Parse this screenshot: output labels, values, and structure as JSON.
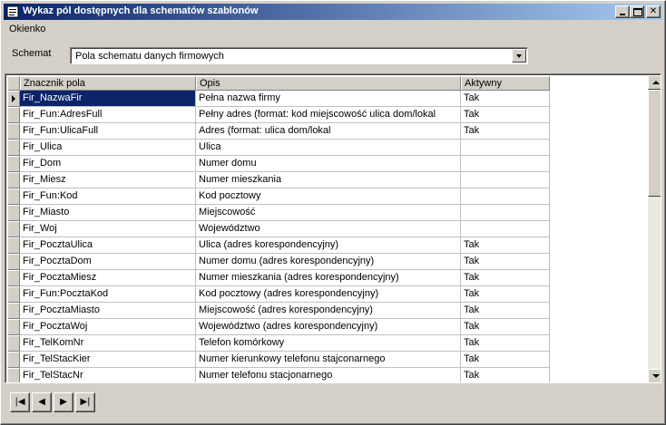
{
  "window": {
    "title": "Wykaz pól dostępnych dla schematów szablonów"
  },
  "menu": {
    "items": [
      "Okienko"
    ]
  },
  "schema": {
    "label": "Schemat",
    "value": "Pola schematu danych firmowych"
  },
  "grid": {
    "columns": [
      "Znacznik pola",
      "Opis",
      "Aktywny"
    ],
    "rows": [
      {
        "tag": "Fir_NazwaFir",
        "desc": "Pełna nazwa firmy",
        "active": "Tak"
      },
      {
        "tag": "Fir_Fun:AdresFull",
        "desc": "Pełny adres (format: kod miejscowość ulica dom/lokal",
        "active": "Tak"
      },
      {
        "tag": "Fir_Fun:UlicaFull",
        "desc": "Adres (format: ulica dom/lokal",
        "active": "Tak"
      },
      {
        "tag": "Fir_Ulica",
        "desc": "Ulica",
        "active": ""
      },
      {
        "tag": "Fir_Dom",
        "desc": "Numer domu",
        "active": ""
      },
      {
        "tag": "Fir_Miesz",
        "desc": "Numer mieszkania",
        "active": ""
      },
      {
        "tag": "Fir_Fun:Kod",
        "desc": "Kod pocztowy",
        "active": ""
      },
      {
        "tag": "Fir_Miasto",
        "desc": "Miejscowość",
        "active": ""
      },
      {
        "tag": "Fir_Woj",
        "desc": "Województwo",
        "active": ""
      },
      {
        "tag": "Fir_PocztaUlica",
        "desc": "Ulica (adres korespondencyjny)",
        "active": "Tak"
      },
      {
        "tag": "Fir_PocztaDom",
        "desc": "Numer domu (adres korespondencyjny)",
        "active": "Tak"
      },
      {
        "tag": "Fir_PocztaMiesz",
        "desc": "Numer mieszkania (adres korespondencyjny)",
        "active": "Tak"
      },
      {
        "tag": "Fir_Fun:PocztaKod",
        "desc": "Kod pocztowy (adres korespondencyjny)",
        "active": "Tak"
      },
      {
        "tag": "Fir_PocztaMiasto",
        "desc": "Miejscowość (adres korespondencyjny)",
        "active": "Tak"
      },
      {
        "tag": "Fir_PocztaWoj",
        "desc": "Województwo (adres korespondencyjny)",
        "active": "Tak"
      },
      {
        "tag": "Fir_TelKomNr",
        "desc": "Telefon komórkowy",
        "active": "Tak"
      },
      {
        "tag": "Fir_TelStacKier",
        "desc": "Numer kierunkowy telefonu stajconarnego",
        "active": "Tak"
      },
      {
        "tag": "Fir_TelStacNr",
        "desc": "Numer telefonu stacjonarnego",
        "active": "Tak"
      }
    ]
  },
  "navigator": {
    "buttons": [
      {
        "name": "first-record-button",
        "glyph": "|◀"
      },
      {
        "name": "prior-record-button",
        "glyph": "◀"
      },
      {
        "name": "next-record-button",
        "glyph": "▶"
      },
      {
        "name": "last-record-button",
        "glyph": "▶|"
      }
    ]
  },
  "colors": {
    "titlebar_start": "#0a246a",
    "titlebar_end": "#a6caf0",
    "selection": "#0a246a",
    "face": "#d4d0c8"
  }
}
